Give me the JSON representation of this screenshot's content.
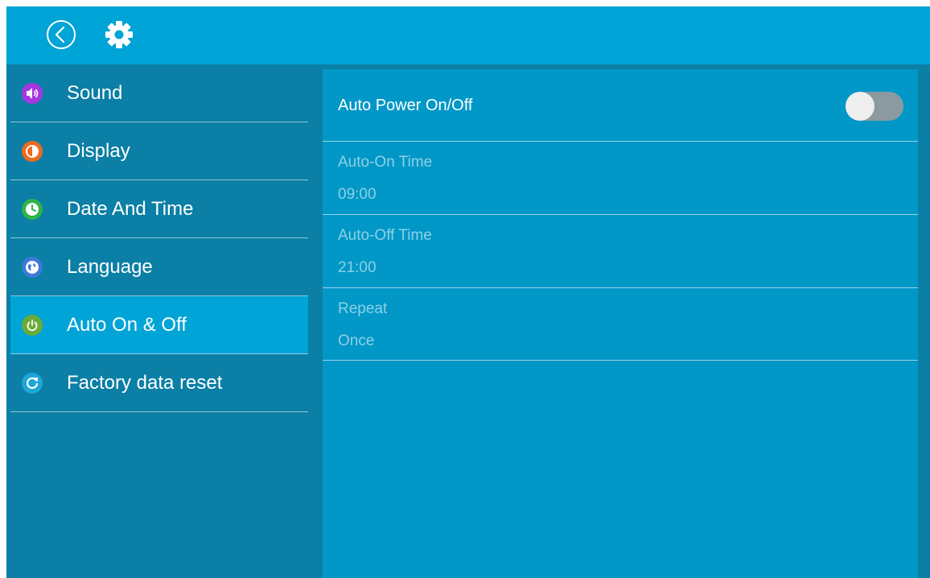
{
  "topbar": {
    "back_icon": "back-circle-icon",
    "settings_icon": "gear-icon"
  },
  "sidebar": {
    "items": [
      {
        "label": "Sound",
        "icon": "speaker-icon",
        "color": "#a636e0"
      },
      {
        "label": "Display",
        "icon": "contrast-icon",
        "color": "#ee6a1c"
      },
      {
        "label": "Date And Time",
        "icon": "clock-icon",
        "color": "#2fb34a"
      },
      {
        "label": "Language",
        "icon": "globe-icon",
        "color": "#3a7ad8"
      },
      {
        "label": "Auto On & Off",
        "icon": "power-icon",
        "color": "#6aab3a"
      },
      {
        "label": "Factory data reset",
        "icon": "refresh-icon",
        "color": "#1ea7d6"
      }
    ],
    "active_index": 4
  },
  "main": {
    "auto_power": {
      "label": "Auto Power On/Off",
      "enabled": false
    },
    "auto_on": {
      "label": "Auto-On Time",
      "value": "09:00"
    },
    "auto_off": {
      "label": "Auto-Off Time",
      "value": "21:00"
    },
    "repeat": {
      "label": "Repeat",
      "value": "Once"
    }
  },
  "colors": {
    "topbar": "#00a4d6",
    "sidebar": "#0b7fa5",
    "content": "#0197c7"
  }
}
